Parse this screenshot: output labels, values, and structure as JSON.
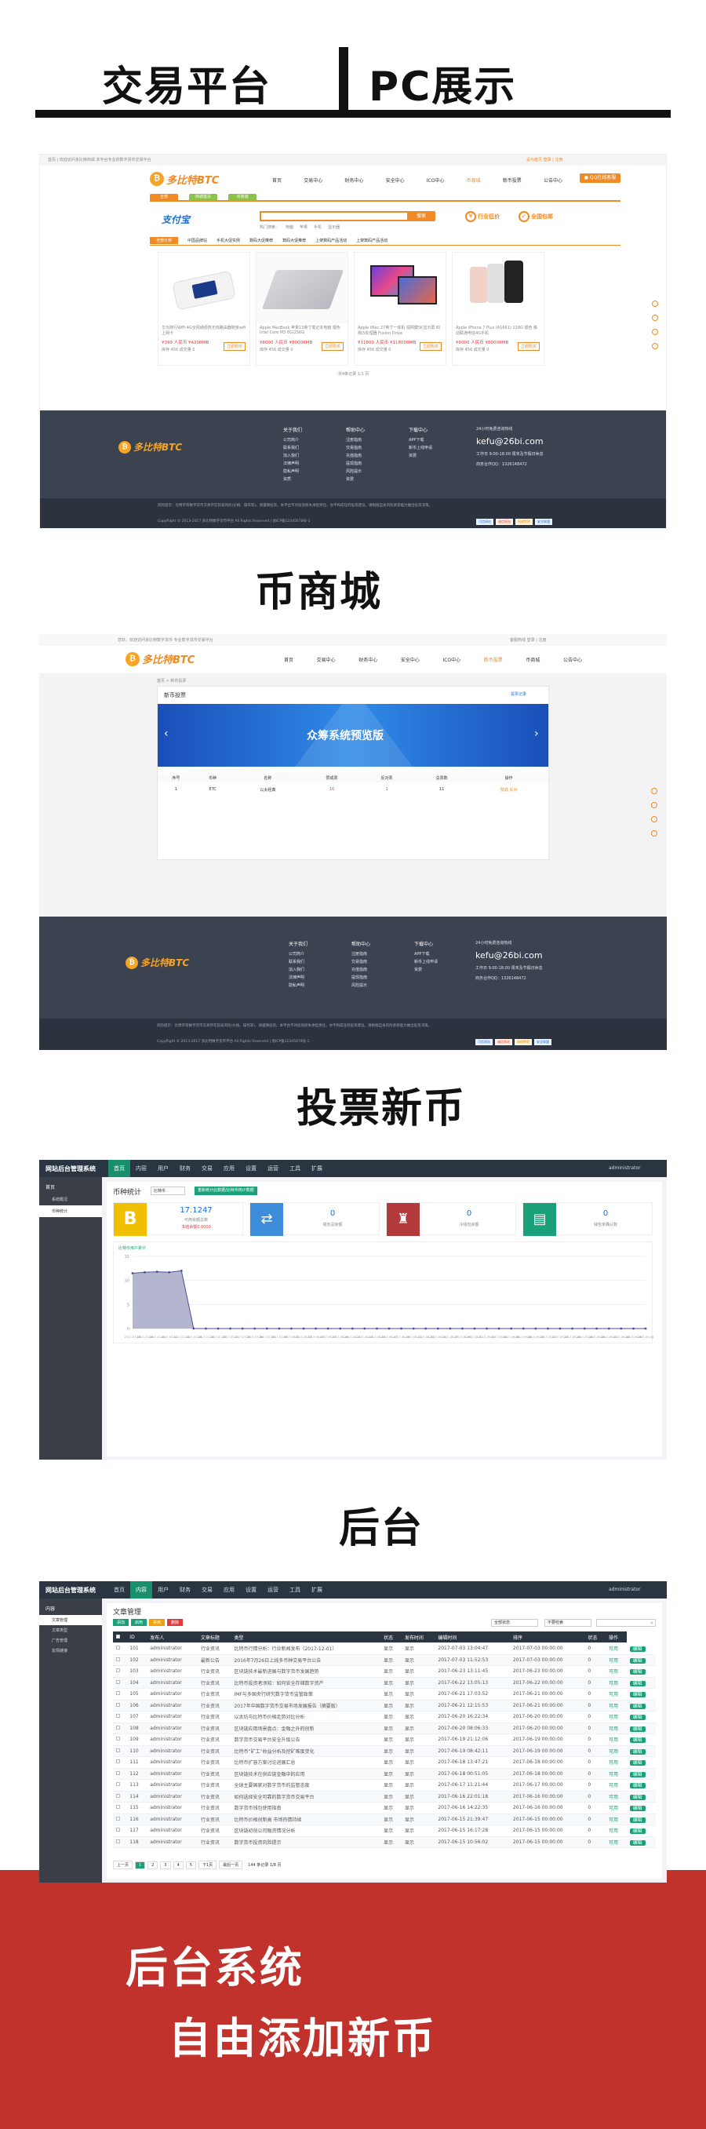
{
  "section_titles": {
    "trading": "交易平台",
    "pc": "PC展示",
    "shop": "币商城",
    "vote": "投票新币",
    "admin": "后台"
  },
  "banner": {
    "line1": "后台系统",
    "line2": "自由添加新币"
  },
  "shop": {
    "topbar_left": "首页 | 欢迎访问多比特商城 本平台专业的数字货币交易平台",
    "topbar_right": "设为首页   登录 | 注册",
    "logo": "多比特BTC",
    "nav": [
      "首页",
      "交易中心",
      "财务中心",
      "安全中心",
      "ICO中心",
      "币商城",
      "新币投票",
      "公告中心"
    ],
    "qq_btn": "QQ在线客服",
    "tabs": [
      "全部",
      "商城首页",
      "币商城"
    ],
    "alipay": "支付宝",
    "search_placeholder": "",
    "search_btn": "搜索",
    "hot_words": [
      "热门搜索：",
      "电脑",
      "苹果",
      "手机",
      "显示器"
    ],
    "promise1": "行业低价",
    "promise2": "全国包邮",
    "cats": [
      "全部分类",
      "中国品牌站",
      "手机大促实例",
      "数码大促推荐",
      "数码大促推荐",
      "上架数码产品活动",
      "上架数码产品活动"
    ],
    "products": [
      {
        "name": "华为随行WiFi 4G全网通便携无线路由器随身wifi上网卡",
        "price": "¥399 人民币 ¥420RMB",
        "meta": "库存 456 成交量 0"
      },
      {
        "name": "Apple MacBook 苹果13英寸笔记本电脑 银色 Intel Core M3 8G/256G",
        "price": "¥8000 人民币 ¥8000RMB",
        "meta": "库存 456 成交量 0"
      },
      {
        "name": "Apple iMac 27英寸一体机 视网膜5K显示屏 四核i5处理器 Fusion Drive",
        "price": "¥11800 人民币 ¥11800RMB",
        "meta": "库存 456 成交量 0"
      },
      {
        "name": "Apple iPhone 7 Plus (A1661) 128G 银色 移动联通电信4G手机",
        "price": "¥6000 人民币 ¥6000RMB",
        "meta": "库存 456 成交量 0"
      }
    ],
    "buy": "立即购买",
    "pager": "共4条记录 1/1 页"
  },
  "footer": {
    "logo": "多比特BTC",
    "col1_title": "关于我们",
    "col1": [
      "公司简介",
      "联系我们",
      "加入我们",
      "法律声明",
      "隐私声明",
      "资质"
    ],
    "col2_title": "帮助中心",
    "col2": [
      "注册指南",
      "交易指南",
      "充值指南",
      "提现指南",
      "风险提示",
      "资费"
    ],
    "col3_title": "下载中心",
    "col3": [
      "APP下载",
      "新币上线申请",
      "资费"
    ],
    "hotline": "24小时免费咨询热线",
    "email": "kefu@26bi.com",
    "work": "工作日 9:00-18:00 周末及节假日休息",
    "qq": "商务合作QQ：1326148472",
    "legal": "风险提示：比特币等数字货币交易存在较高风险(价格、操作等)，请谨慎投资。本平台不对投资损失承担责任，亦不构成任何投资建议。请根据自身风险承受能力做出投资决策。",
    "copyright": "CopyRight © 2013-2017 多比特数字货币平台 All Rights Reserved | 浙ICP备12345678号-1",
    "badges": [
      "可信网站",
      "诚信网站",
      "网络警察",
      "安全联盟"
    ]
  },
  "vote": {
    "topbar_left": "您好，欢迎访问多比特数字货币 专业数字货币交易平台",
    "topbar_right": "客服热线  登录 | 注册",
    "logo": "多比特BTC",
    "nav": [
      "首页",
      "交易中心",
      "财务中心",
      "安全中心",
      "ICO中心",
      "新币投票",
      "币商城",
      "公告中心"
    ],
    "crumb": "首页 > 新币投票",
    "panel_title": "新币投票",
    "panel_link": "投票记录",
    "banner_text": "众筹系统预览版",
    "headers": [
      "序号",
      "币种",
      "名称",
      "赞成票",
      "反对票",
      "总票数",
      "操作"
    ],
    "row": [
      "1",
      "ETC",
      "以太经典",
      "10",
      "1",
      "11",
      "赞成  反对"
    ]
  },
  "admin1": {
    "brand": "网站后台管理系统",
    "tabs": [
      "首页",
      "内容",
      "用户",
      "财务",
      "交易",
      "应用",
      "设置",
      "运营",
      "工具",
      "扩展"
    ],
    "user": "administrator",
    "side_title": "首页",
    "side_items": [
      "系统概况",
      "币种统计"
    ],
    "page_title": "币种统计",
    "coin_select": "比特币",
    "refresh": "重新统计此数据/比特币统计数据",
    "cards": [
      {
        "icon": "B",
        "value": "17.1247",
        "sub": "可用余额总数",
        "extra": "冻结余额0.0000"
      },
      {
        "icon": "⇄",
        "value": "0",
        "sub": "钱包总余额"
      },
      {
        "icon": "♜",
        "value": "0",
        "sub": "冷钱包余额"
      },
      {
        "icon": "▤",
        "value": "0",
        "sub": "钱包未确认数"
      }
    ],
    "chart_title": "比特币用户累计",
    "chart_data": {
      "type": "area",
      "x": [
        "2017-07-06",
        "2017-07-08",
        "2017-07-10",
        "2017-07-12",
        "2017-07-14",
        "2017-07-16",
        "2017-07-18",
        "2017-07-20",
        "2017-07-22",
        "2017-07-24",
        "2017-07-26",
        "2017-07-28",
        "2017-07-30",
        "2017-08-01",
        "2017-08-03",
        "2017-08-05",
        "2017-08-07",
        "2017-08-09",
        "2017-08-11",
        "2017-08-13",
        "2017-08-15",
        "2017-08-17",
        "2017-08-19",
        "2017-08-21",
        "2017-08-23",
        "2017-08-25",
        "2017-08-27",
        "2017-08-29",
        "2017-08-31",
        "2017-09-02",
        "2017-09-04",
        "2017-09-06",
        "2017-09-08",
        "2017-09-10",
        "2017-09-12",
        "2017-09-14",
        "2017-09-16",
        "2017-09-18",
        "2017-09-20",
        "2017-09-22",
        "2017-09-24",
        "2017-09-26",
        "2017-09-28"
      ],
      "values": [
        11.5,
        11.7,
        11.8,
        11.7,
        12,
        0,
        0,
        0,
        0,
        0,
        0,
        0,
        0,
        0,
        0,
        0,
        0,
        0,
        0,
        0,
        0,
        0,
        0,
        0,
        0,
        0,
        0,
        0,
        0,
        0,
        0,
        0,
        0,
        0,
        0,
        0,
        0,
        0,
        0,
        0,
        0,
        0,
        0
      ],
      "ylim": [
        0,
        15
      ],
      "yticks": [
        "15",
        "10",
        "5",
        "0"
      ]
    }
  },
  "admin2": {
    "brand": "网站后台管理系统",
    "tabs": [
      "首页",
      "内容",
      "用户",
      "财务",
      "交易",
      "应用",
      "设置",
      "运营",
      "工具",
      "扩展"
    ],
    "user": "administrator",
    "side_title": "内容",
    "side_items": [
      "文章管理",
      "文章类型",
      "广告管理",
      "友情链接"
    ],
    "page_title": "文章管理",
    "actions": [
      "添加",
      "启用",
      "禁用",
      "删除"
    ],
    "filter1": "全部状态",
    "filter2": "不要检索",
    "headers": [
      "",
      "ID",
      "发布人",
      "文章标题",
      "类型",
      "状态",
      "发布时间",
      "编辑时间",
      "排序",
      "状态",
      "操作"
    ],
    "rows": [
      [
        "101",
        "administrator",
        "行业资讯",
        "比特币行情分析：行业新闻发布（2017-12-01）",
        "显示",
        "显示",
        "2017-07-03 13:04:47",
        "2017-07-03 00:00:00",
        "0",
        "可用",
        "编辑"
      ],
      [
        "102",
        "administrator",
        "最新公告",
        "2016年7月26日上线多币种交易平台公告",
        "显示",
        "显示",
        "2017-07-03 11:52:53",
        "2017-07-03 00:00:00",
        "0",
        "可用",
        "编辑"
      ],
      [
        "103",
        "administrator",
        "行业资讯",
        "区块链技术最新进展与数字货币发展趋势",
        "显示",
        "显示",
        "2017-06-23 13:11:45",
        "2017-06-23 00:00:00",
        "0",
        "可用",
        "编辑"
      ],
      [
        "104",
        "administrator",
        "行业资讯",
        "比特币投资者须知：如何安全存储数字资产",
        "显示",
        "显示",
        "2017-06-22 13:05:13",
        "2017-06-22 00:00:00",
        "0",
        "可用",
        "编辑"
      ],
      [
        "105",
        "administrator",
        "行业资讯",
        "IMF与多国央行研究数字货币监管政策",
        "显示",
        "显示",
        "2017-06-21 17:03:52",
        "2017-06-21 00:00:00",
        "0",
        "可用",
        "编辑"
      ],
      [
        "106",
        "administrator",
        "行业资讯",
        "2017年中国数字货币交易市场发展报告（摘要版）",
        "显示",
        "显示",
        "2017-06-21 12:15:53",
        "2017-06-21 00:00:00",
        "0",
        "可用",
        "编辑"
      ],
      [
        "107",
        "administrator",
        "行业资讯",
        "以太坊与比特币价格走势对比分析",
        "显示",
        "显示",
        "2017-06-20 16:22:34",
        "2017-06-20 00:00:00",
        "0",
        "可用",
        "编辑"
      ],
      [
        "108",
        "administrator",
        "行业资讯",
        "区块链应用场景盘点：金融之外的创新",
        "显示",
        "显示",
        "2017-06-20 08:06:33",
        "2017-06-20 00:00:00",
        "0",
        "可用",
        "编辑"
      ],
      [
        "109",
        "administrator",
        "行业资讯",
        "数字货币交易平台安全升级公告",
        "显示",
        "显示",
        "2017-06-19 21:12:06",
        "2017-06-19 00:00:00",
        "0",
        "可用",
        "编辑"
      ],
      [
        "110",
        "administrator",
        "行业资讯",
        "比特币“矿工”收益分析及挖矿难度变化",
        "显示",
        "显示",
        "2017-06-19 08:42:11",
        "2017-06-19 00:00:00",
        "0",
        "可用",
        "编辑"
      ],
      [
        "111",
        "administrator",
        "行业资讯",
        "比特币扩容方案讨论进展汇总",
        "显示",
        "显示",
        "2017-06-18 13:47:21",
        "2017-06-18 00:00:00",
        "0",
        "可用",
        "编辑"
      ],
      [
        "112",
        "administrator",
        "行业资讯",
        "区块链技术在供应链金融中的应用",
        "显示",
        "显示",
        "2017-06-18 00:51:05",
        "2017-06-18 00:00:00",
        "0",
        "可用",
        "编辑"
      ],
      [
        "113",
        "administrator",
        "行业资讯",
        "全球主要国家对数字货币的监管态度",
        "显示",
        "显示",
        "2017-06-17 11:21:44",
        "2017-06-17 00:00:00",
        "0",
        "可用",
        "编辑"
      ],
      [
        "114",
        "administrator",
        "行业资讯",
        "如何选择安全可靠的数字货币交易平台",
        "显示",
        "显示",
        "2017-06-16 22:01:18",
        "2017-06-16 00:00:00",
        "0",
        "可用",
        "编辑"
      ],
      [
        "115",
        "administrator",
        "行业资讯",
        "数字货币钱包使用指南",
        "显示",
        "显示",
        "2017-06-16 14:22:35",
        "2017-06-16 00:00:00",
        "0",
        "可用",
        "编辑"
      ],
      [
        "116",
        "administrator",
        "行业资讯",
        "比特币价格创新高 市场热情持续",
        "显示",
        "显示",
        "2017-06-15 21:39:47",
        "2017-06-15 00:00:00",
        "0",
        "可用",
        "编辑"
      ],
      [
        "117",
        "administrator",
        "行业资讯",
        "区块链初创公司融资情况分析",
        "显示",
        "显示",
        "2017-06-15 16:17:28",
        "2017-06-15 00:00:00",
        "0",
        "可用",
        "编辑"
      ],
      [
        "118",
        "administrator",
        "行业资讯",
        "数字货币投资风险提示",
        "显示",
        "显示",
        "2017-06-15 10:56:02",
        "2017-06-15 00:00:00",
        "0",
        "可用",
        "编辑"
      ]
    ],
    "pager": [
      "上一页",
      "1",
      "2",
      "3",
      "4",
      "5",
      "下1页",
      "最后一页",
      "144 条记录 1/8 页"
    ]
  }
}
